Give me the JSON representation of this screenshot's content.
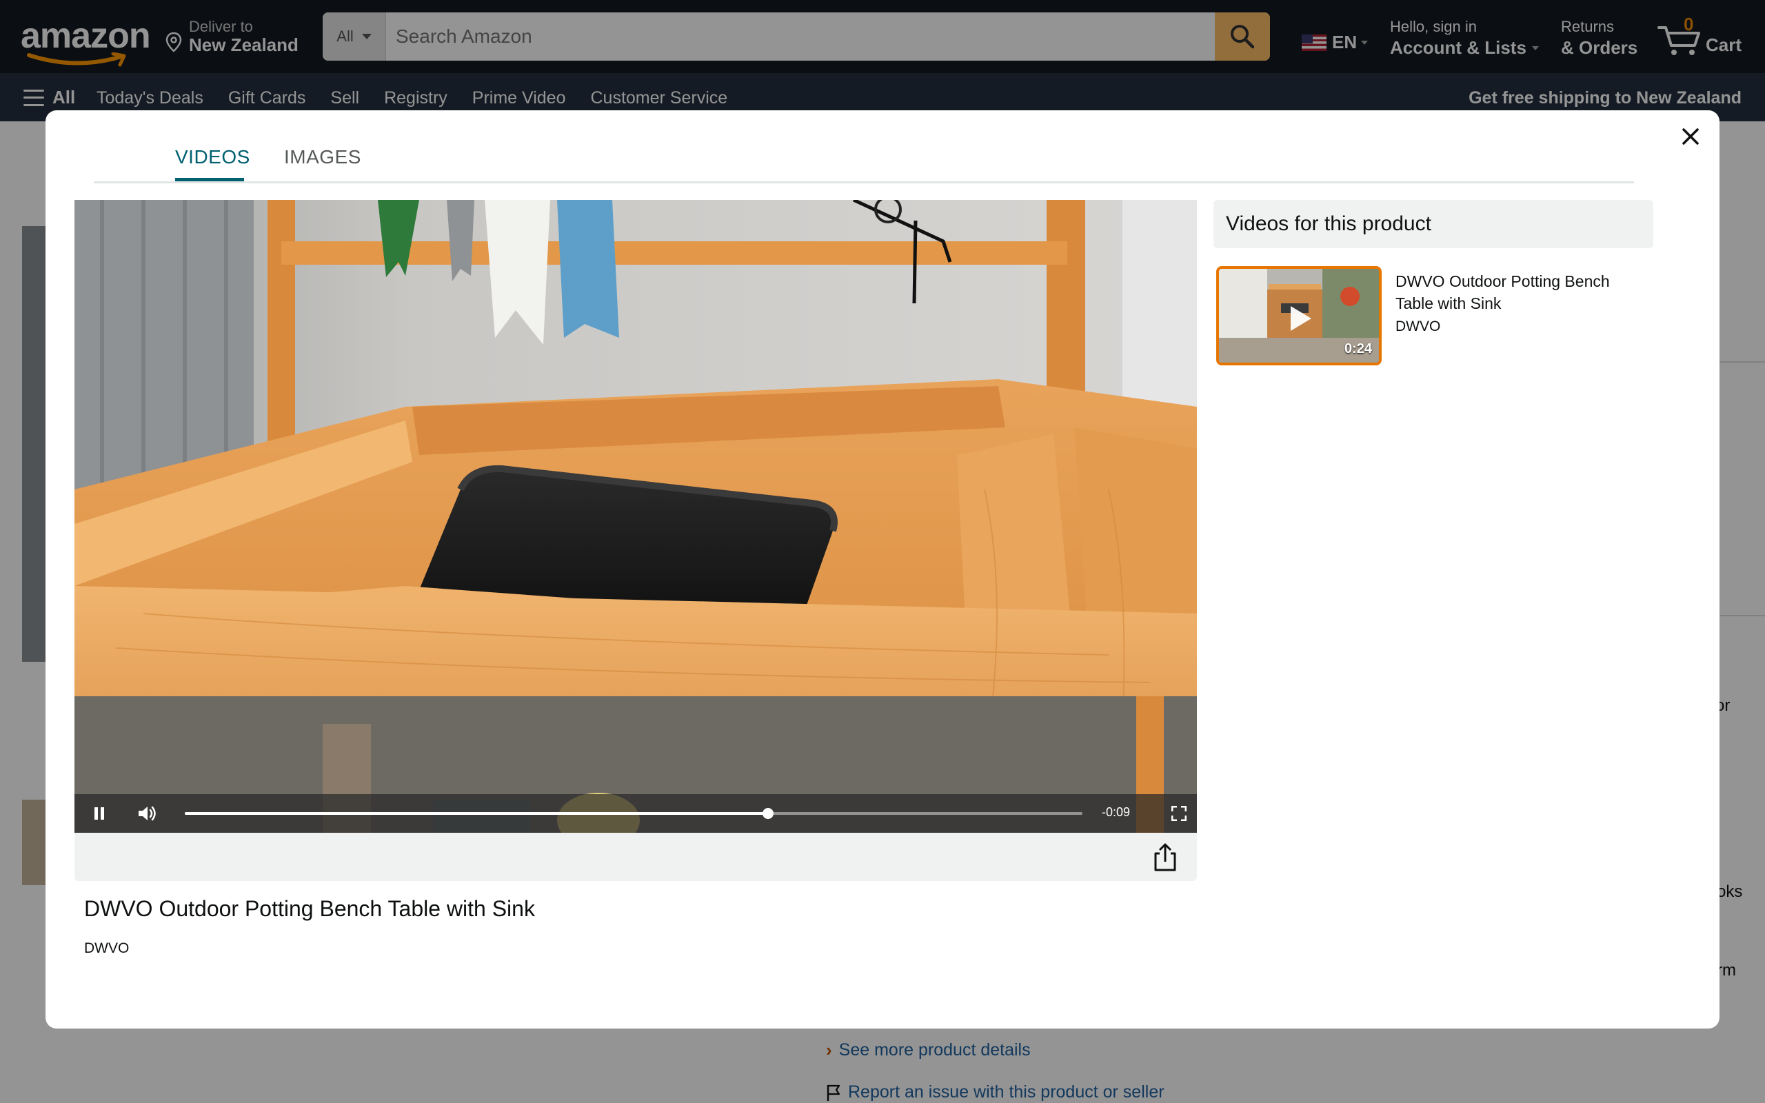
{
  "header": {
    "logo_text": "amazon",
    "deliver_label": "Deliver to",
    "deliver_location": "New Zealand",
    "search_category": "All",
    "search_placeholder": "Search Amazon",
    "language": "EN",
    "account_greeting": "Hello, sign in",
    "account_label": "Account & Lists",
    "returns_label": "Returns",
    "orders_label": "& Orders",
    "cart_count": "0",
    "cart_label": "Cart"
  },
  "nav": {
    "all_label": "All",
    "links": [
      "Today's Deals",
      "Gift Cards",
      "Sell",
      "Registry",
      "Prime Video",
      "Customer Service"
    ],
    "shipping_banner": "Get free shipping to New Zealand"
  },
  "background_page": {
    "fragment_1": "or",
    "fragment_2": "oks",
    "fragment_3": "rm",
    "link_more_details": "See more product details",
    "link_report": "Report an issue with this product or seller"
  },
  "modal": {
    "tabs": [
      {
        "label": "VIDEOS",
        "active": true
      },
      {
        "label": "IMAGES",
        "active": false
      }
    ],
    "player": {
      "time_remaining": "-0:09",
      "progress_fraction": 0.65,
      "state": "playing"
    },
    "video_title": "DWVO Outdoor Potting Bench Table with Sink",
    "video_brand": "DWVO",
    "sidebar": {
      "heading": "Videos for this product",
      "items": [
        {
          "title": "DWVO Outdoor Potting Bench Table with Sink",
          "brand": "DWVO",
          "duration": "0:24"
        }
      ]
    }
  },
  "colors": {
    "header_bg": "#131921",
    "nav_bg": "#232f3e",
    "search_button": "#febd69",
    "active_tab": "#006070",
    "thumb_border": "#e77600",
    "link": "#2162a1"
  }
}
